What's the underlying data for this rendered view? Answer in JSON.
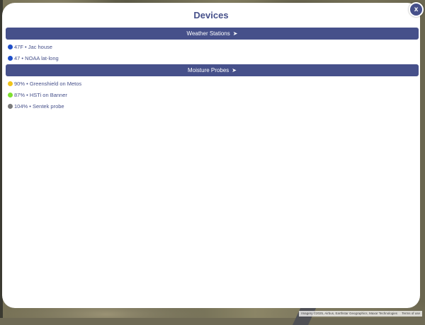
{
  "modal": {
    "title": "Devices",
    "close_label": "x"
  },
  "sections": [
    {
      "label": "Weather Stations",
      "arrow": "➤",
      "items": [
        {
          "value": "47F",
          "separator": " • ",
          "name": "Jac house",
          "dot_color": "#1f4fc9"
        },
        {
          "value": "47",
          "separator": " • ",
          "name": "NOAA lat-long",
          "dot_color": "#1f4fc9"
        }
      ]
    },
    {
      "label": "Moisture Probes",
      "arrow": "➤",
      "items": [
        {
          "value": "90%",
          "separator": " • ",
          "name": "Greenshield on Metos",
          "dot_color": "#f0c419"
        },
        {
          "value": "87%",
          "separator": " • ",
          "name": "HSTi on Banner",
          "dot_color": "#7ee02f"
        },
        {
          "value": "104%",
          "separator": " • ",
          "name": "Sentek probe",
          "dot_color": "#7a7a7a"
        }
      ]
    }
  ],
  "map": {
    "attribution": "Imagery ©2025, Airbus, Earthstar Geographics, Maxar Technologies",
    "terms": "Terms of use"
  }
}
